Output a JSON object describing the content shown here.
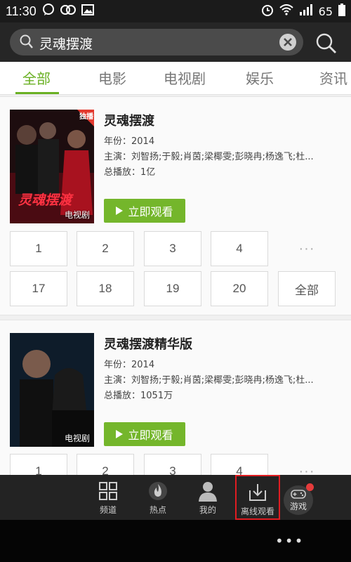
{
  "status_bar": {
    "time": "11:30",
    "battery": "65"
  },
  "search": {
    "query": "灵魂摆渡"
  },
  "tabs": [
    {
      "label": "全部",
      "active": true
    },
    {
      "label": "电影"
    },
    {
      "label": "电视剧"
    },
    {
      "label": "娱乐"
    },
    {
      "label": "资讯"
    }
  ],
  "results": [
    {
      "title": "灵魂摆渡",
      "poster_tag": "电视剧",
      "poster_text": "灵魂摆渡",
      "poster_badge": "独播",
      "year": "年份：2014",
      "cast": "主演：刘智扬;于毅;肖茵;梁椰雯;彭晓冉;杨逸飞;杜...",
      "plays": "总播放：1亿",
      "watch_label": "立即观看",
      "episodes_row1": [
        "1",
        "2",
        "3",
        "4",
        "···"
      ],
      "episodes_row2": [
        "17",
        "18",
        "19",
        "20",
        "全部"
      ]
    },
    {
      "title": "灵魂摆渡精华版",
      "poster_tag": "电视剧",
      "year": "年份：2014",
      "cast": "主演：刘智扬;于毅;肖茵;梁椰雯;彭晓冉;杨逸飞;杜...",
      "plays": "总播放：1051万",
      "watch_label": "立即观看",
      "episodes_row1": [
        "1",
        "2",
        "3",
        "4",
        "···"
      ]
    }
  ],
  "bottom_nav": [
    {
      "label": "频道",
      "icon": "grid-icon"
    },
    {
      "label": "热点",
      "icon": "flame-icon"
    },
    {
      "label": "我的",
      "icon": "person-icon"
    },
    {
      "label": "离线观看",
      "icon": "download-icon"
    },
    {
      "label": "游戏",
      "icon": "gamepad-icon"
    }
  ],
  "system_bar": {
    "menu_glyph": "•••"
  },
  "colors": {
    "accent": "#6ab023",
    "watch_button": "#74b62b",
    "highlight": "#e01d22"
  }
}
